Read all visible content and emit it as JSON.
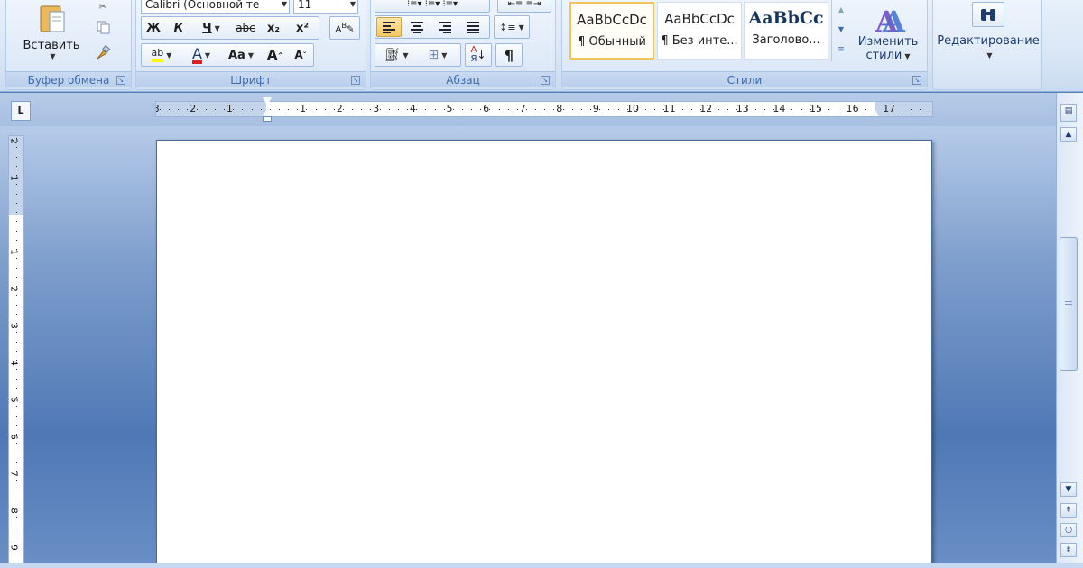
{
  "clipboard": {
    "paste_label": "Вставить",
    "group_label": "Буфер обмена"
  },
  "font": {
    "family_value": "Calibri (Основной те",
    "size_value": "11",
    "bold": "Ж",
    "italic": "К",
    "underline": "Ч",
    "strike": "abc",
    "subscript": "x₂",
    "superscript": "x²",
    "highlight": "ab",
    "font_color": "A",
    "change_case": "Aa",
    "grow": "A",
    "shrink": "A",
    "group_label": "Шрифт"
  },
  "paragraph": {
    "pilcrow": "¶",
    "group_label": "Абзац"
  },
  "styles": {
    "items": [
      {
        "sample": "AaBbCcDc",
        "name": "¶ Обычный"
      },
      {
        "sample": "AaBbCcDc",
        "name": "¶ Без инте..."
      },
      {
        "sample": "AaBbCc",
        "name": "Заголово..."
      }
    ],
    "change_label_1": "Изменить",
    "change_label_2": "стили",
    "group_label": "Стили"
  },
  "editing": {
    "label": "Редактирование"
  },
  "ruler": {
    "tab_selector": "L",
    "h_numbers": [
      "3",
      "2",
      "1",
      "1",
      "2",
      "3",
      "4",
      "5",
      "6",
      "7",
      "8",
      "9",
      "10",
      "11",
      "12",
      "13",
      "14",
      "15",
      "16",
      "17"
    ],
    "v_numbers": [
      "2",
      "1",
      "1",
      "2",
      "3",
      "4",
      "5",
      "6",
      "7",
      "8",
      "9"
    ]
  },
  "colors": {
    "accent": "#3e6aaa",
    "font_color_bar": "#e02020",
    "highlight_bar": "#ffff00"
  }
}
